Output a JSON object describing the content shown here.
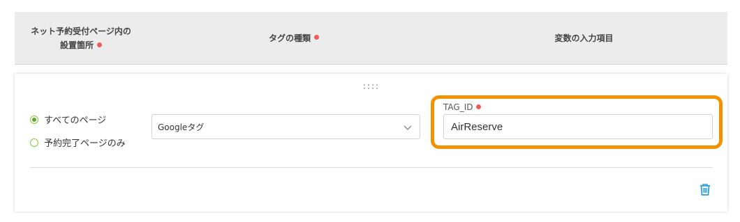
{
  "table_header": {
    "col1_label": "ネット予約受付ページ内の\n設置箇所",
    "col2_label": "タグの種類",
    "col3_label": "変数の入力項目"
  },
  "row": {
    "placement": {
      "options": [
        {
          "label": "すべてのページ",
          "selected": true
        },
        {
          "label": "予約完了ページのみ",
          "selected": false
        }
      ]
    },
    "tag_type": {
      "value": "Googleタグ"
    },
    "variable": {
      "label": "TAG_ID",
      "value": "AirReserve"
    }
  },
  "colors": {
    "required_dot": "#ef5b5b",
    "highlight": "#f39200",
    "radio": "#5aad2c",
    "trash_icon": "#2a9fd6"
  },
  "icons": [
    "drag-handle-icon",
    "chevron-down-icon",
    "trash-icon"
  ]
}
